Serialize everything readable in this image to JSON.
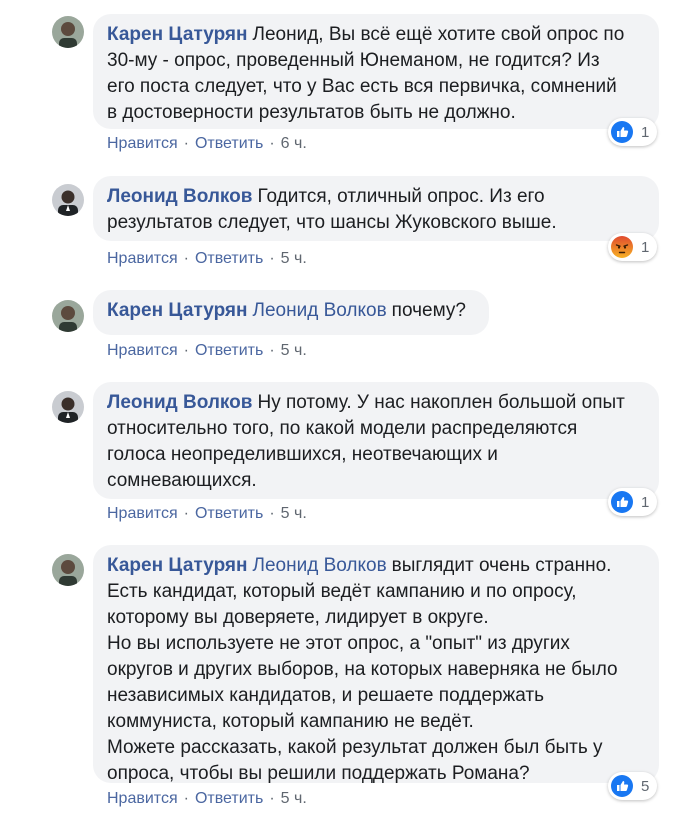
{
  "comments": [
    {
      "author": "Карен Цатурян",
      "mention": "",
      "text": "Леонид, Вы всё ещё хотите свой опрос по\n30-му - опрос, проведенный Юнеманом, не годится? Из\nего поста следует, что у Вас есть вся первичка, сомнений\nв достоверности результатов быть не должно.",
      "reaction": {
        "icon": "like-icon",
        "count": "1"
      },
      "like_label": "Нравится",
      "reply_label": "Ответить",
      "time": "6 ч."
    },
    {
      "author": "Леонид Волков",
      "mention": "",
      "text": "Годится, отличный опрос. Из его\nрезультатов следует, что шансы Жуковского выше.",
      "reaction": {
        "icon": "angry-icon",
        "count": "1"
      },
      "like_label": "Нравится",
      "reply_label": "Ответить",
      "time": "5 ч."
    },
    {
      "author": "Карен Цатурян",
      "mention": "Леонид Волков",
      "text": "почему?",
      "reaction": null,
      "like_label": "Нравится",
      "reply_label": "Ответить",
      "time": "5 ч."
    },
    {
      "author": "Леонид Волков",
      "mention": "",
      "text": "Ну потому. У нас накоплен большой опыт\nотносительно того, по какой модели распределяются\nголоса неопределившихся, неотвечающих и\nсомневающихся.",
      "reaction": {
        "icon": "like-icon",
        "count": "1"
      },
      "like_label": "Нравится",
      "reply_label": "Ответить",
      "time": "5 ч."
    },
    {
      "author": "Карен Цатурян",
      "mention": "Леонид Волков",
      "text": "выглядит очень странно.\nЕсть кандидат, который ведёт кампанию и по опросу,\nкоторому вы доверяете, лидирует в округе.\nНо вы используете не этот опрос, а \"опыт\" из других\nокругов и других выборов, на которых наверняка не было\nнезависимых кандидатов, и решаете поддержать\nкоммуниста, который кампанию не ведёт.\nМожете рассказать, какой результат должен был быть у\nопроса, чтобы вы решили поддержать Романа?",
      "reaction": {
        "icon": "like-icon",
        "count": "5"
      },
      "like_label": "Нравится",
      "reply_label": "Ответить",
      "time": "5 ч."
    }
  ],
  "colors": {
    "author": "#385898",
    "bubble": "#f2f3f5",
    "like_blue": "#1877f2",
    "angry_red": "#e9710f"
  }
}
